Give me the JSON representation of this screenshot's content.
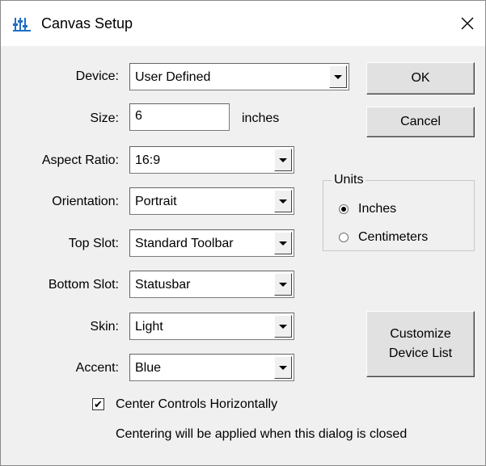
{
  "window": {
    "title": "Canvas Setup",
    "app_icon": "sliders-icon",
    "close_glyph": "✕"
  },
  "form": {
    "device": {
      "label": "Device:",
      "value": "User Defined"
    },
    "size": {
      "label": "Size:",
      "value": "6",
      "unit": "inches"
    },
    "aspect_ratio": {
      "label": "Aspect Ratio:",
      "value": "16:9"
    },
    "orientation": {
      "label": "Orientation:",
      "value": "Portrait"
    },
    "top_slot": {
      "label": "Top Slot:",
      "value": "Standard Toolbar"
    },
    "bottom_slot": {
      "label": "Bottom Slot:",
      "value": "Statusbar"
    },
    "skin": {
      "label": "Skin:",
      "value": "Light"
    },
    "accent": {
      "label": "Accent:",
      "value": "Blue"
    }
  },
  "buttons": {
    "ok": "OK",
    "cancel": "Cancel",
    "customize_line1": "Customize",
    "customize_line2": "Device List"
  },
  "units": {
    "title": "Units",
    "options": [
      {
        "label": "Inches",
        "selected": true
      },
      {
        "label": "Centimeters",
        "selected": false
      }
    ]
  },
  "center": {
    "label": "Center Controls Horizontally",
    "checked": true,
    "check_glyph": "✔",
    "note": "Centering will be applied when this dialog is closed"
  },
  "colors": {
    "dialog_bg": "#f0f0f0",
    "titlebar_bg": "#ffffff",
    "icon_blue": "#1f6fc5"
  }
}
